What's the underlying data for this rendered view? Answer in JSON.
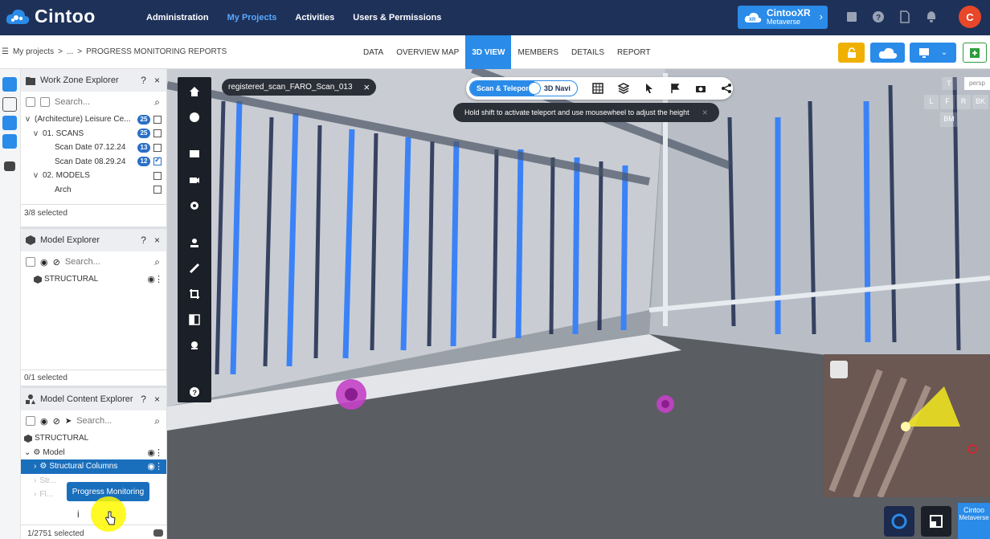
{
  "app": {
    "logo_text": "Cintoo",
    "nav": [
      "Administration",
      "My Projects",
      "Activities",
      "Users & Permissions"
    ],
    "active_nav": "My Projects",
    "xr_button": {
      "main": "CintooXR",
      "sub": "Metaverse"
    },
    "avatar_letter": "C"
  },
  "breadcrumb": {
    "root": "My projects",
    "sep1": ">",
    "ellipsis": "...",
    "sep2": ">",
    "current": "PROGRESS MONITORING REPORTS"
  },
  "tabs": [
    {
      "label": "DATA"
    },
    {
      "label": "OVERVIEW MAP"
    },
    {
      "label": "3D VIEW",
      "active": true
    },
    {
      "label": "MEMBERS"
    },
    {
      "label": "DETAILS"
    },
    {
      "label": "REPORT"
    }
  ],
  "work_zone": {
    "title": "Work Zone Explorer",
    "help": "?",
    "close": "×",
    "search_placeholder": "Search...",
    "rows": [
      {
        "label": "(Architecture) Leisure Ce...",
        "badge": "25",
        "indent": 0,
        "chevron": "v"
      },
      {
        "label": "01. SCANS",
        "badge": "25",
        "indent": 1,
        "chevron": "v"
      },
      {
        "label": "Scan Date 07.12.24",
        "badge": "13",
        "indent": 2
      },
      {
        "label": "Scan Date 08.29.24",
        "badge": "12",
        "indent": 2,
        "checked": true
      },
      {
        "label": "02. MODELS",
        "indent": 1,
        "chevron": "v"
      },
      {
        "label": "Arch",
        "indent": 2
      }
    ],
    "footer": "3/8 selected"
  },
  "model_explorer": {
    "title": "Model Explorer",
    "help": "?",
    "close": "×",
    "search_placeholder": "Search...",
    "item": "STRUCTURAL",
    "footer": "0/1 selected"
  },
  "model_content": {
    "title": "Model Content Explorer",
    "help": "?",
    "close": "×",
    "search_placeholder": "Search...",
    "root": "STRUCTURAL",
    "model": "Model",
    "selected_item": "Structural Columns",
    "faded_items": [
      "Str...",
      "Fl..."
    ],
    "info": "i",
    "footer": "1/2751 selected"
  },
  "viewport": {
    "scan_tab": "registered_scan_FARO_Scan_013",
    "scan_tab_close": "×",
    "toggle_on": "Scan & Teleport",
    "toggle_off": "3D Navi",
    "hint": "Hold shift to activate teleport and use mousewheel to adjust the height",
    "hint_close": "×",
    "viewcube": {
      "top": "T",
      "persp": "persp",
      "left": "L",
      "front": "F",
      "right": "R",
      "back": "BK",
      "bottom": "BM"
    },
    "badge_text": "Cintoo",
    "badge_sub": "Metaverse"
  },
  "tooltip": "Progress Monitoring",
  "colors": {
    "navbar": "#1e3159",
    "accent": "#2a8be8",
    "active_nav": "#5aa8ff",
    "warning": "#f0b000",
    "success": "#2e9d3c",
    "marker": "#c341c7"
  }
}
